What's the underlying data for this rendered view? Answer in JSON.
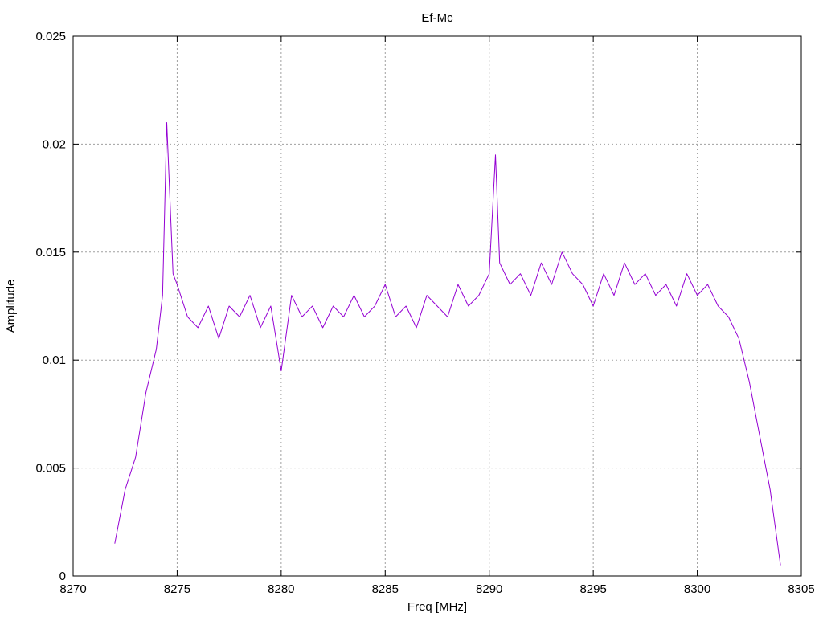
{
  "chart_data": {
    "type": "line",
    "title": "Ef-Mc",
    "xlabel": "Freq [MHz]",
    "ylabel": "Amplitude",
    "xlim": [
      8270,
      8305
    ],
    "ylim": [
      0,
      0.025
    ],
    "xticks": [
      8270,
      8275,
      8280,
      8285,
      8290,
      8295,
      8300,
      8305
    ],
    "xtick_labels": [
      "8270",
      "8275",
      "8280",
      "8285",
      "8290",
      "8295",
      "8300",
      "8305"
    ],
    "yticks": [
      0,
      0.005,
      0.01,
      0.015,
      0.02,
      0.025
    ],
    "ytick_labels": [
      "0",
      "0.005",
      "0.01",
      "0.015",
      "0.02",
      "0.025"
    ],
    "grid": true,
    "series": [
      {
        "color": "#9400d3",
        "x": [
          8272.0,
          8272.5,
          8273.0,
          8273.5,
          8274.0,
          8274.3,
          8274.5,
          8274.8,
          8275.0,
          8275.5,
          8276.0,
          8276.5,
          8277.0,
          8277.5,
          8278.0,
          8278.5,
          8279.0,
          8279.5,
          8280.0,
          8280.5,
          8281.0,
          8281.5,
          8282.0,
          8282.5,
          8283.0,
          8283.5,
          8284.0,
          8284.5,
          8285.0,
          8285.5,
          8286.0,
          8286.5,
          8287.0,
          8287.5,
          8288.0,
          8288.5,
          8289.0,
          8289.5,
          8290.0,
          8290.3,
          8290.5,
          8291.0,
          8291.5,
          8292.0,
          8292.5,
          8293.0,
          8293.5,
          8294.0,
          8294.5,
          8295.0,
          8295.5,
          8296.0,
          8296.5,
          8297.0,
          8297.5,
          8298.0,
          8298.5,
          8299.0,
          8299.5,
          8300.0,
          8300.5,
          8301.0,
          8301.5,
          8302.0,
          8302.5,
          8303.0,
          8303.5,
          8304.0
        ],
        "y": [
          0.0015,
          0.004,
          0.0055,
          0.0085,
          0.0105,
          0.013,
          0.021,
          0.014,
          0.0135,
          0.012,
          0.0115,
          0.0125,
          0.011,
          0.0125,
          0.012,
          0.013,
          0.0115,
          0.0125,
          0.0095,
          0.013,
          0.012,
          0.0125,
          0.0115,
          0.0125,
          0.012,
          0.013,
          0.012,
          0.0125,
          0.0135,
          0.012,
          0.0125,
          0.0115,
          0.013,
          0.0125,
          0.012,
          0.0135,
          0.0125,
          0.013,
          0.014,
          0.0195,
          0.0145,
          0.0135,
          0.014,
          0.013,
          0.0145,
          0.0135,
          0.015,
          0.014,
          0.0135,
          0.0125,
          0.014,
          0.013,
          0.0145,
          0.0135,
          0.014,
          0.013,
          0.0135,
          0.0125,
          0.014,
          0.013,
          0.0135,
          0.0125,
          0.012,
          0.011,
          0.009,
          0.0065,
          0.004,
          0.0005
        ]
      }
    ]
  }
}
